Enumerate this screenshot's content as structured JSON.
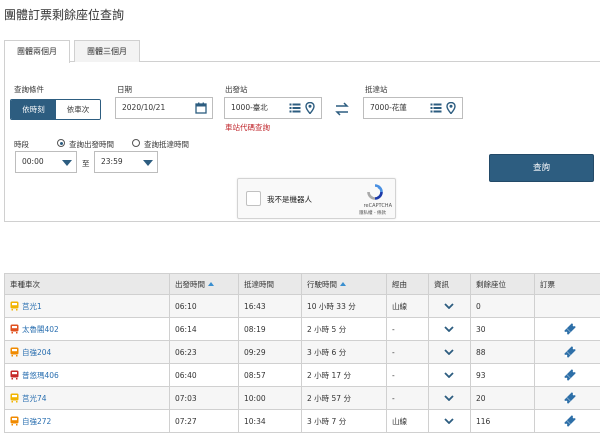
{
  "page": {
    "title": "團體訂票剩餘座位查詢"
  },
  "tabs": [
    {
      "label": "團體兩個月",
      "active": true
    },
    {
      "label": "團體三個月",
      "active": false
    }
  ],
  "form": {
    "query_condition_label": "查詢條件",
    "mode_options": [
      "依時刻",
      "依車次"
    ],
    "mode_selected": "依時刻",
    "date_label": "日期",
    "date_value": "2020/10/21",
    "departure_label": "出發站",
    "departure_value": "1000-臺北",
    "arrival_label": "抵達站",
    "arrival_value": "7000-花蓮",
    "station_code_link": "車站代碼查詢",
    "time_period_label": "時段",
    "time_options": [
      "查詢出發時間",
      "查詢抵達時間"
    ],
    "time_selected": "查詢出發時間",
    "time_from": "00:00",
    "time_to_label": "至",
    "time_to": "23:59",
    "submit_label": "查詢"
  },
  "captcha": {
    "label": "我不是機器人",
    "brand": "reCAPTCHA",
    "terms": "隱私權 - 條款"
  },
  "table": {
    "headers": [
      "車種車次",
      "出發時間",
      "抵達時間",
      "行駛時間",
      "經由",
      "資訊",
      "剩餘座位",
      "訂票"
    ],
    "rows": [
      {
        "train": "莒光1",
        "type": "chukuang",
        "dep": "06:10",
        "arr": "16:43",
        "duration": "10 小時 33 分",
        "via": "山線",
        "seats": "0",
        "bookable": false
      },
      {
        "train": "太魯閣402",
        "type": "taroko",
        "dep": "06:14",
        "arr": "08:19",
        "duration": "2 小時 5 分",
        "via": "-",
        "seats": "30",
        "bookable": true
      },
      {
        "train": "自強204",
        "type": "tze-chiang",
        "dep": "06:23",
        "arr": "09:29",
        "duration": "3 小時 6 分",
        "via": "-",
        "seats": "88",
        "bookable": true
      },
      {
        "train": "普悠瑪406",
        "type": "puyuma",
        "dep": "06:40",
        "arr": "08:57",
        "duration": "2 小時 17 分",
        "via": "-",
        "seats": "93",
        "bookable": true
      },
      {
        "train": "莒光74",
        "type": "chukuang",
        "dep": "07:03",
        "arr": "10:00",
        "duration": "2 小時 57 分",
        "via": "-",
        "seats": "20",
        "bookable": true
      },
      {
        "train": "自強272",
        "type": "tze-chiang",
        "dep": "07:27",
        "arr": "10:34",
        "duration": "3 小時 7 分",
        "via": "山線",
        "seats": "116",
        "bookable": true
      }
    ]
  },
  "colors": {
    "primary": "#2d5d80",
    "link": "#2a6fb0",
    "alert": "#c0272d",
    "chukuang": "#f2b400",
    "taroko": "#e0501e",
    "tze_chiang": "#f08a00",
    "puyuma": "#c62828"
  }
}
